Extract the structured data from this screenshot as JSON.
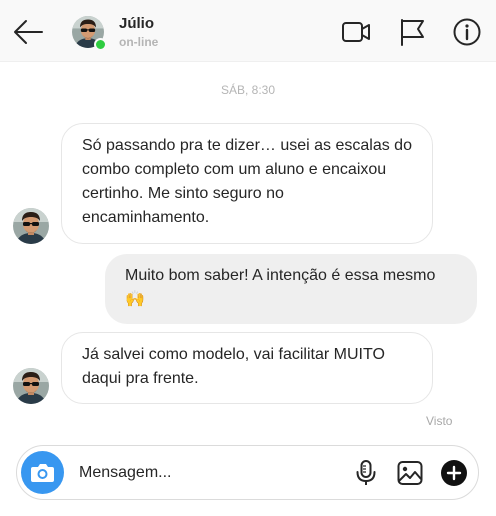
{
  "header": {
    "contact_name": "Júlio",
    "status": "on-line"
  },
  "conversation": {
    "timestamp": "SÁB, 8:30",
    "messages": [
      {
        "direction": "incoming",
        "text": "Só passando pra te dizer… usei as escalas do combo completo com um aluno e encaixou certinho. Me sinto seguro no encaminhamento."
      },
      {
        "direction": "outgoing",
        "text": "Muito bom saber! A intenção é essa mesmo",
        "emoji": "🙌"
      },
      {
        "direction": "incoming",
        "text": "Já salvei como modelo, vai facilitar MUITO daqui pra frente."
      }
    ],
    "seen_label": "Visto"
  },
  "composer": {
    "placeholder": "Mensagem...",
    "icons": [
      "camera-icon",
      "microphone-icon",
      "gallery-icon",
      "plus-icon"
    ]
  },
  "colors": {
    "accent": "#3897f0",
    "online": "#2ecc40",
    "incoming_bubble": "#ffffff",
    "outgoing_bubble": "#efefef"
  }
}
